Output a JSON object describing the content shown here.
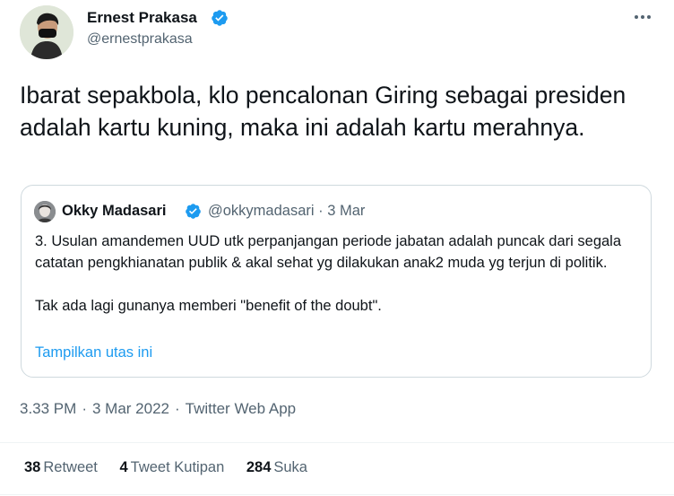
{
  "author": {
    "name": "Ernest Prakasa",
    "handle": "@ernestprakasa"
  },
  "tweet_text": "Ibarat sepakbola, klo pencalonan Giring sebagai presiden adalah kartu kuning, maka ini adalah kartu merahnya.",
  "quoted": {
    "name": "Okky Madasari",
    "handle": "@okkymadasari",
    "separator": "·",
    "date": "3 Mar",
    "paragraphs": [
      "3. Usulan amandemen UUD utk perpanjangan periode jabatan adalah puncak dari segala catatan pengkhianatan publik & akal sehat yg dilakukan anak2 muda yg terjun di politik.",
      "Tak ada lagi gunanya memberi \"benefit of the doubt\"."
    ],
    "thread_link": "Tampilkan utas ini"
  },
  "meta": {
    "time": "3.33 PM",
    "date": "3 Mar 2022",
    "source": "Twitter Web App",
    "separator": "·"
  },
  "stats": {
    "retweets_count": "38",
    "retweets_label": "Retweet",
    "quotes_count": "4",
    "quotes_label": "Tweet Kutipan",
    "likes_count": "284",
    "likes_label": "Suka"
  },
  "colors": {
    "verified": "#1d9bf0",
    "link": "#1d9bf0",
    "secondary_text": "#536471"
  },
  "icons": {
    "verified": "verified-badge-icon",
    "more": "more-options-icon"
  }
}
